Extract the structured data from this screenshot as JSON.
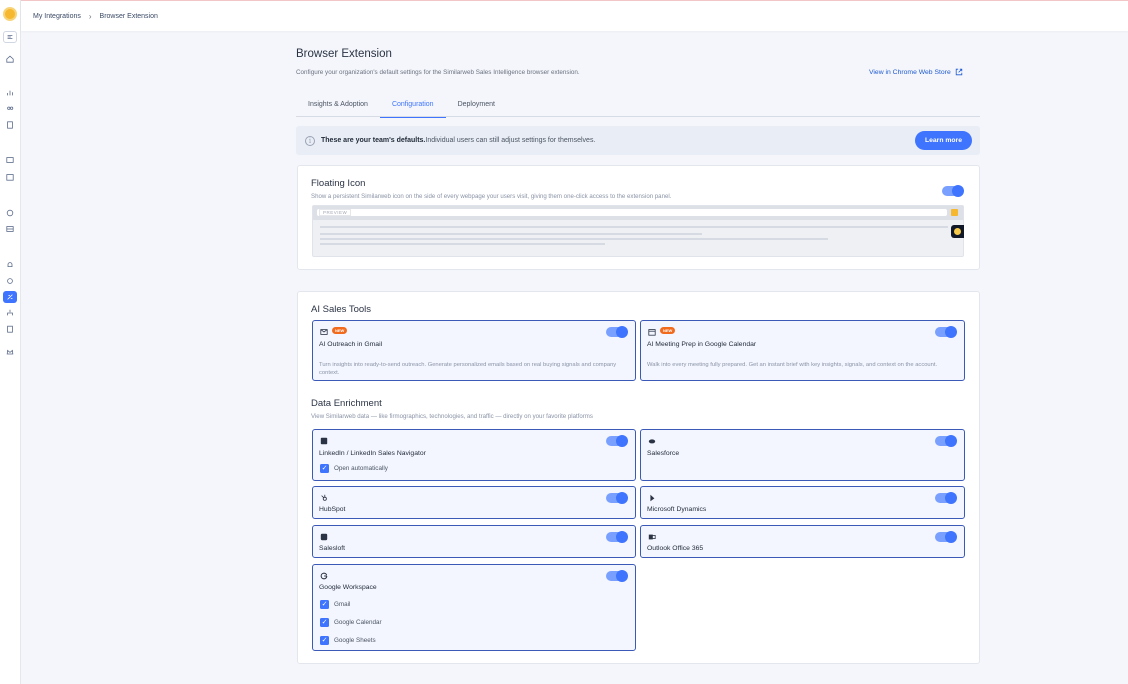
{
  "breadcrumb": {
    "parent": "My Integrations",
    "separator": "›",
    "current": "Browser Extension"
  },
  "page": {
    "title": "Browser Extension",
    "subtitle": "Configure your organization's default settings for the Similarweb Sales Intelligence browser extension.",
    "store_link": "View in Chrome Web Store"
  },
  "tabs": [
    {
      "label": "Insights & Adoption",
      "active": false
    },
    {
      "label": "Configuration",
      "active": true
    },
    {
      "label": "Deployment",
      "active": false
    }
  ],
  "banner": {
    "bold": "These are your team's defaults.",
    "text": "Individual users can still adjust settings for themselves.",
    "button": "Learn more",
    "icon": "info-icon"
  },
  "floating_icon": {
    "title": "Floating Icon",
    "description": "Show a persistent Similarweb icon on the side of every webpage your users visit, giving them one-click access to the extension panel.",
    "enabled": true,
    "preview_label": "PREVIEW"
  },
  "ai_sales_tools": {
    "title": "AI Sales Tools",
    "items": [
      {
        "name": "AI Outreach in Gmail",
        "badge": "NEW",
        "icon": "mail-ai-icon",
        "enabled": true,
        "description": "Turn insights into ready-to-send outreach. Generate personalized emails based on real buying signals and company context."
      },
      {
        "name": "AI Meeting Prep in Google Calendar",
        "badge": "NEW",
        "icon": "calendar-ai-icon",
        "enabled": true,
        "description": "Walk into every meeting fully prepared. Get an instant brief with key insights, signals, and context on the account."
      }
    ]
  },
  "data_enrichment": {
    "title": "Data Enrichment",
    "description": "View Similarweb data — like firmographics, technologies, and traffic — directly on your favorite platforms",
    "items": [
      {
        "name": "LinkedIn / LinkedIn Sales Navigator",
        "icon": "linkedin-icon",
        "enabled": true,
        "options": [
          "Open automatically"
        ]
      },
      {
        "name": "Salesforce",
        "icon": "salesforce-icon",
        "enabled": true,
        "options": []
      },
      {
        "name": "HubSpot",
        "icon": "hubspot-icon",
        "enabled": true,
        "options": []
      },
      {
        "name": "Microsoft Dynamics",
        "icon": "dynamics-icon",
        "enabled": true,
        "options": []
      },
      {
        "name": "Salesloft",
        "icon": "salesloft-icon",
        "enabled": true,
        "options": []
      },
      {
        "name": "Outlook Office 365",
        "icon": "outlook-icon",
        "enabled": true,
        "options": []
      },
      {
        "name": "Google Workspace",
        "icon": "google-icon",
        "enabled": true,
        "options": [
          "Gmail",
          "Google Calendar",
          "Google Sheets"
        ]
      }
    ]
  },
  "colors": {
    "accent": "#3e74fe",
    "badge": "#f26b1d",
    "tile_border": "#3b5ab8",
    "background": "#f4f6fb"
  }
}
